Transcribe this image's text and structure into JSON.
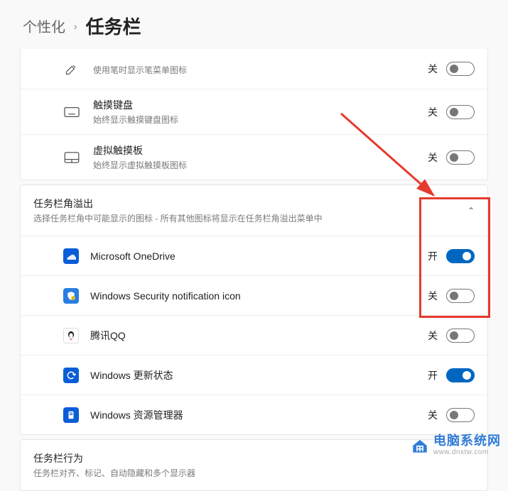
{
  "breadcrumb": {
    "parent": "个性化",
    "current": "任务栏"
  },
  "corner_icons": {
    "pen": {
      "title": "",
      "sub": "使用笔时显示笔菜单图标",
      "state": "关",
      "on": false
    },
    "touch_keyboard": {
      "title": "触摸键盘",
      "sub": "始终显示触摸键盘图标",
      "state": "关",
      "on": false
    },
    "virtual_touchpad": {
      "title": "虚拟触摸板",
      "sub": "始终显示虚拟触摸板图标",
      "state": "关",
      "on": false
    }
  },
  "overflow": {
    "header_title": "任务栏角溢出",
    "header_sub": "选择任务栏角中可能显示的图标 - 所有其他图标将显示在任务栏角溢出菜单中",
    "items": [
      {
        "name": "Microsoft OneDrive",
        "state": "开",
        "on": true,
        "icon": "cloud"
      },
      {
        "name": "Windows Security notification icon",
        "state": "关",
        "on": false,
        "icon": "shield"
      },
      {
        "name": "腾讯QQ",
        "state": "关",
        "on": false,
        "icon": "penguin"
      },
      {
        "name": "Windows 更新状态",
        "state": "开",
        "on": true,
        "icon": "update"
      },
      {
        "name": "Windows 资源管理器",
        "state": "关",
        "on": false,
        "icon": "explorer"
      }
    ]
  },
  "behavior": {
    "title": "任务栏行为",
    "sub": "任务栏对齐、标记、自动隐藏和多个显示器"
  },
  "watermark": {
    "cn": "电脑系统网",
    "url": "www.dnxtw.com"
  }
}
